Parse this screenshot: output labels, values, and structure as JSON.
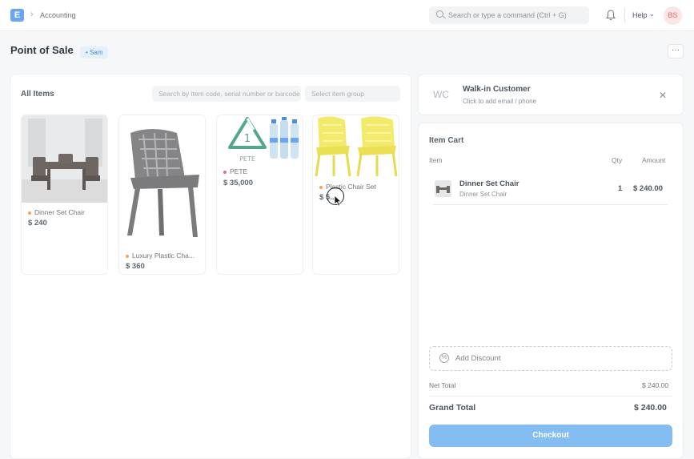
{
  "navbar": {
    "logo_letter": "E",
    "breadcrumb": "Accounting",
    "search_placeholder": "Search or type a command (Ctrl + G)",
    "help_label": "Help",
    "avatar_initials": "BS"
  },
  "page": {
    "title": "Point of Sale",
    "badge": "Sam",
    "more_label": "···"
  },
  "items_panel": {
    "title": "All Items",
    "search_placeholder": "Search by item code, serial number or barcode",
    "group_placeholder": "Select item group",
    "items": [
      {
        "name": "Dinner Set Chair",
        "price": "$ 240",
        "dot_color": "#f5a54c"
      },
      {
        "name": "Luxury Plastic Cha...",
        "price": "$ 360",
        "dot_color": "#f5a54c"
      },
      {
        "name": "PETE",
        "price": "$ 35,000",
        "dot_color": "#e86a8a"
      },
      {
        "name": "Plastic Chair Set",
        "price": "$ 5...",
        "dot_color": "#f5a54c"
      }
    ],
    "pete_caption": "PETE",
    "recycle_number": "1"
  },
  "customer": {
    "initials": "WC",
    "name": "Walk-in Customer",
    "subtitle": "Click to add email / phone"
  },
  "cart": {
    "title": "Item Cart",
    "headers": {
      "item": "Item",
      "qty": "Qty",
      "amount": "Amount"
    },
    "line": {
      "name": "Dinner Set Chair",
      "sub": "Dinner Set Chair",
      "qty": "1",
      "amount": "$ 240.00"
    },
    "discount_label": "Add Discount",
    "net_total_label": "Net Total",
    "net_total": "$ 240.00",
    "grand_total_label": "Grand Total",
    "grand_total": "$ 240.00",
    "checkout_label": "Checkout"
  },
  "colors": {
    "accent": "#84bdf2",
    "brand": "#6aa5f5"
  }
}
